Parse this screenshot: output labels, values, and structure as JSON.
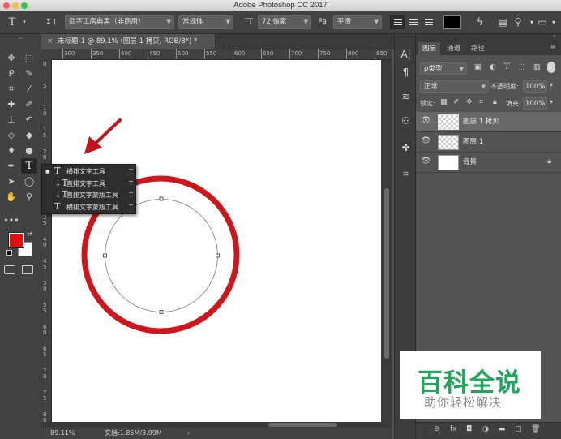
{
  "window": {
    "title": "Adobe Photoshop CC 2017"
  },
  "options_bar": {
    "tool_glyph": "T",
    "orient_glyph": "↕T",
    "font_family": "造字工房典黑（非商用）",
    "font_style": "常规体",
    "font_size": "72 像素",
    "aa_label": "ªa",
    "antialias": "平滑",
    "text_color": "#000000"
  },
  "document": {
    "tab_title": "未标题-1 @ 89.1% (图层 1 拷贝, RGB/8*) *",
    "zoom": "89.11%",
    "doc_info": "文档:1.85M/3.99M",
    "status_arrow": "›"
  },
  "rulers": {
    "h_ticks": [
      "300",
      "350",
      "400",
      "450",
      "500",
      "550",
      "600",
      "650",
      "700",
      "750",
      "800",
      "850"
    ],
    "v_ticks": [
      "0",
      "5",
      "1\n0",
      "1\n5",
      "2\n0",
      "2\n5",
      "3\n0",
      "3\n5",
      "4\n0",
      "4\n5",
      "5\n0",
      "5\n5",
      "6\n0",
      "6\n5",
      "7\n0",
      "7\n5",
      "8\n0"
    ]
  },
  "toolbar": {
    "foreground_color": "#e00f10",
    "background_color": "#ffffff",
    "tools": [
      {
        "name": "move-tool",
        "icon": "move-icon",
        "glyph": "✥"
      },
      {
        "name": "marquee-tool",
        "icon": "marquee-icon",
        "glyph": "⬚"
      },
      {
        "name": "lasso-tool",
        "icon": "lasso-icon",
        "glyph": "ᑭ"
      },
      {
        "name": "quick-select-tool",
        "icon": "magic-wand-icon",
        "glyph": "✎"
      },
      {
        "name": "crop-tool",
        "icon": "crop-icon",
        "glyph": "⌗"
      },
      {
        "name": "eyedropper-tool",
        "icon": "eyedropper-icon",
        "glyph": "⁄"
      },
      {
        "name": "healing-tool",
        "icon": "bandage-icon",
        "glyph": "✚"
      },
      {
        "name": "brush-tool",
        "icon": "brush-icon",
        "glyph": "✐"
      },
      {
        "name": "stamp-tool",
        "icon": "stamp-icon",
        "glyph": "⊥"
      },
      {
        "name": "history-brush-tool",
        "icon": "history-brush-icon",
        "glyph": "↶"
      },
      {
        "name": "eraser-tool",
        "icon": "eraser-icon",
        "glyph": "◇"
      },
      {
        "name": "bucket-tool",
        "icon": "bucket-icon",
        "glyph": "◆"
      },
      {
        "name": "blur-tool",
        "icon": "blur-icon",
        "glyph": "♦"
      },
      {
        "name": "dodge-tool",
        "icon": "dodge-icon",
        "glyph": "●"
      },
      {
        "name": "pen-tool",
        "icon": "pen-icon",
        "glyph": "✒"
      },
      {
        "name": "type-tool",
        "icon": "type-icon",
        "glyph": "T"
      },
      {
        "name": "path-select-tool",
        "icon": "arrow-icon",
        "glyph": "➤"
      },
      {
        "name": "ellipse-tool",
        "icon": "ellipse-icon",
        "glyph": "◯"
      },
      {
        "name": "hand-tool",
        "icon": "hand-icon",
        "glyph": "✋"
      },
      {
        "name": "zoom-tool",
        "icon": "zoom-icon",
        "glyph": "⚲"
      }
    ],
    "more": "•••"
  },
  "type_flyout": {
    "items": [
      {
        "label": "横排文字工具",
        "key": "T",
        "glyph": "T",
        "active": true
      },
      {
        "label": "直排文字工具",
        "key": "T",
        "glyph": "↓T",
        "active": false
      },
      {
        "label": "直排文字蒙版工具",
        "key": "T",
        "glyph": "↓T",
        "active": false
      },
      {
        "label": "横排文字蒙版工具",
        "key": "T",
        "glyph": "T",
        "active": false
      }
    ],
    "bullet": "■"
  },
  "layers_panel": {
    "tabs": [
      "图层",
      "通道",
      "路径"
    ],
    "filter_label": "ρ类型",
    "blend_mode": "正常",
    "opacity_label": "不透明度:",
    "opacity_value": "100%",
    "lock_label": "锁定:",
    "fill_label": "填充:",
    "fill_value": "100%",
    "layers": [
      {
        "name": "图层 1 拷贝",
        "selected": true,
        "thumb": "checker"
      },
      {
        "name": "图层 1",
        "selected": false,
        "thumb": "checker"
      },
      {
        "name": "背景",
        "selected": false,
        "thumb": "white",
        "locked": true
      }
    ],
    "bottom_icons": [
      "⊖",
      "fx",
      "◘",
      "◑",
      "▬",
      "▢",
      "🗑"
    ]
  },
  "panel_strip": {
    "icons": [
      "A|",
      "¶",
      "≋",
      "⚇",
      "✤",
      "⌗"
    ]
  },
  "canvas": {
    "ring_color": "#d0151b",
    "path_color": "#777777",
    "arrow_color": "#c0161c"
  },
  "watermark": {
    "title": "百科全说",
    "subtitle": "助你轻松解决",
    "title_color": "#21a55b"
  }
}
